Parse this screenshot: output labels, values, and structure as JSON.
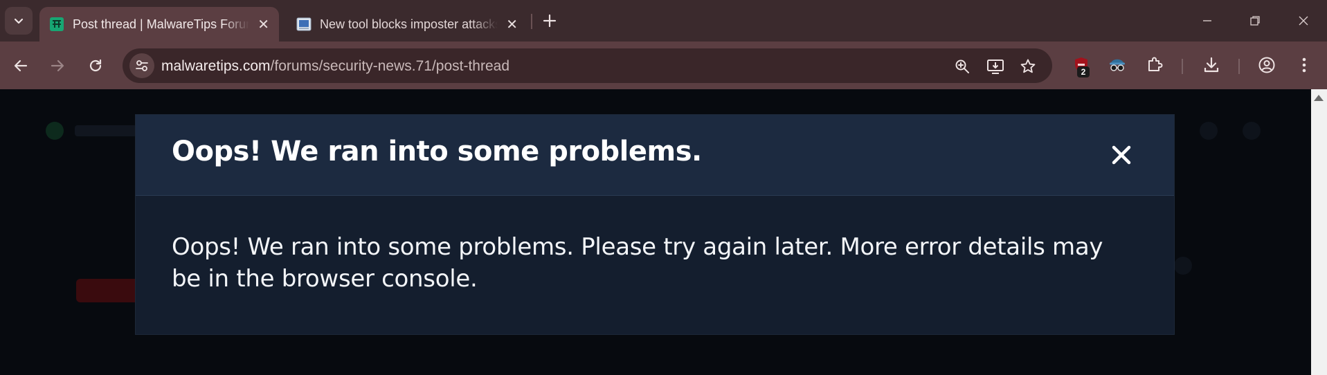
{
  "browser": {
    "tabs": [
      {
        "title": "Post thread | MalwareTips Forum",
        "active": true,
        "favicon": "malwaretips-favicon"
      },
      {
        "title": "New tool blocks imposter attacks",
        "active": false,
        "favicon": "news-favicon"
      }
    ],
    "address": {
      "domain": "malwaretips.com",
      "path": "/forums/security-news.71/post-thread"
    },
    "extension_badge": "2"
  },
  "modal": {
    "title": "Oops! We ran into some problems.",
    "message": "Oops! We ran into some problems. Please try again later. More error details may be in the browser console."
  },
  "colors": {
    "tabstrip": "#3b2a2d",
    "toolbar": "#5b3e42",
    "modal_header": "#1c2a40",
    "modal_body": "#141e2e",
    "page_bg": "#070a0f"
  }
}
